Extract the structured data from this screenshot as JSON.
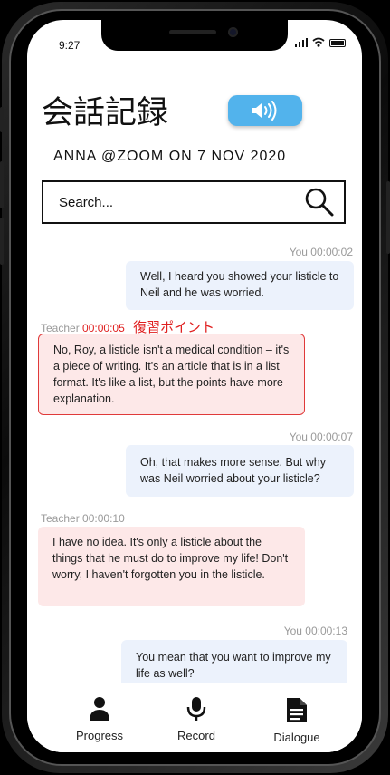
{
  "status": {
    "time": "9:27"
  },
  "header": {
    "title": "会話記録",
    "meta": "ANNA  @ZOOM ON 7 NOV 2020"
  },
  "search": {
    "placeholder": "Search..."
  },
  "messages": [
    {
      "speaker": "You",
      "time": "00:00:02",
      "text": "Well, I heard you showed your listicle to Neil and he was worried."
    },
    {
      "speaker": "Teacher",
      "time": "00:00:05",
      "flag": "復習ポイント",
      "text": "No, Roy, a listicle isn't a medical condition – it's a piece of writing. It's an article that is in a list format. It's like a list, but the points have more explanation."
    },
    {
      "speaker": "You",
      "time": "00:00:07",
      "text": "Oh, that makes more sense. But why was Neil worried about your listicle?"
    },
    {
      "speaker": "Teacher",
      "time": "00:00:10",
      "text": "I have no idea. It's only a listicle about the things that he must do to improve my life! Don't worry, I haven't forgotten you in the listicle."
    },
    {
      "speaker": "You",
      "time": "00:00:13",
      "text": "You mean that you want to improve my life as well?"
    }
  ],
  "nav": [
    {
      "label": "Progress",
      "icon": "person-icon"
    },
    {
      "label": "Record",
      "icon": "microphone-icon"
    },
    {
      "label": "Dialogue",
      "icon": "document-icon"
    }
  ],
  "colors": {
    "accent": "#52b3ec",
    "flag": "#e02020",
    "you_bubble": "#ecf2fc",
    "teacher_bubble": "#fde8e8"
  }
}
